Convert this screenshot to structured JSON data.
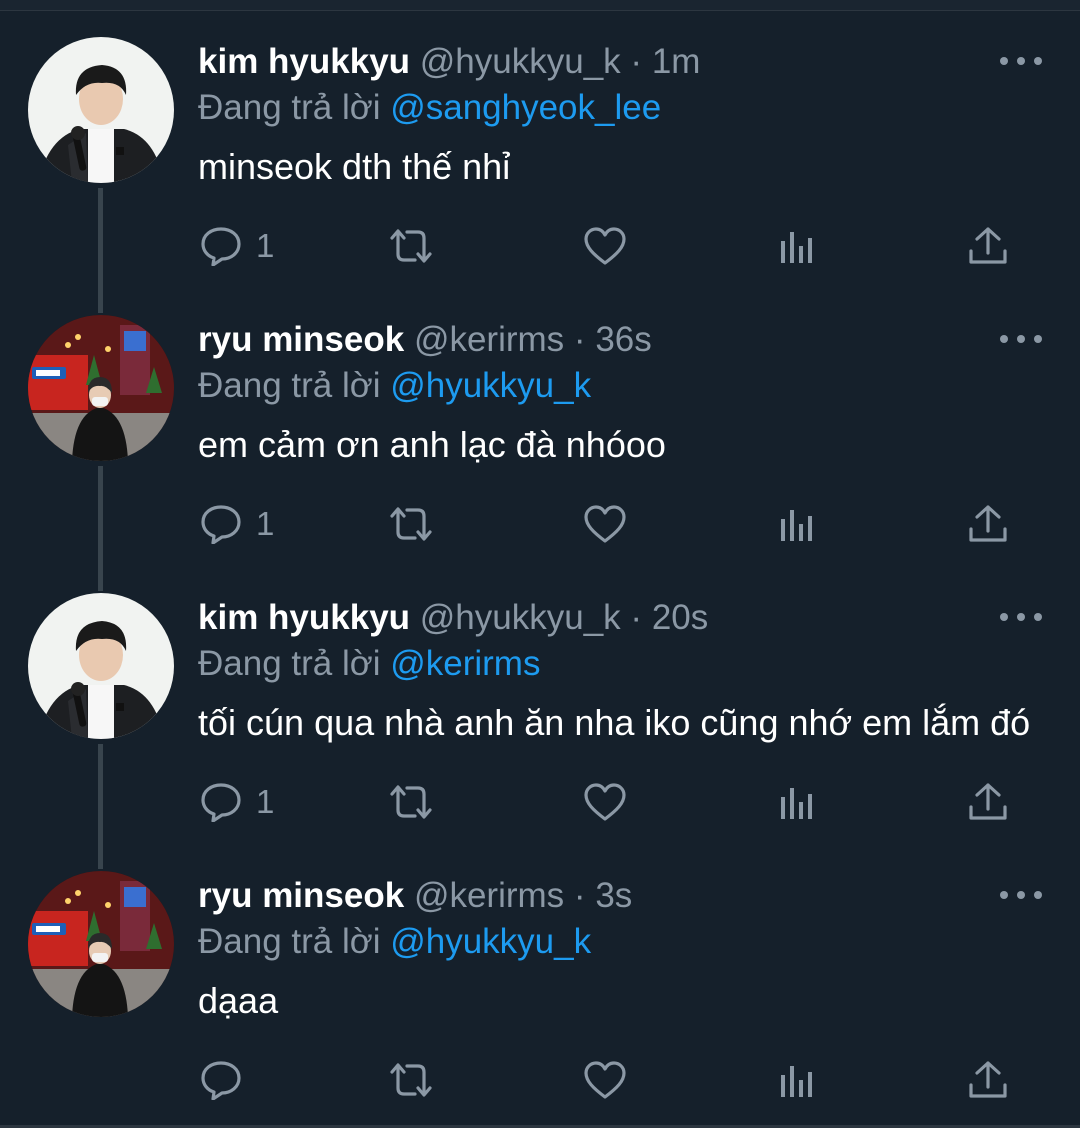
{
  "reply_prefix": "Đang trả lời",
  "colors": {
    "background": "#15202b",
    "text": "#ffffff",
    "muted": "#8b98a5",
    "link": "#1d9bf0",
    "thread_line": "#38444d"
  },
  "icons": {
    "reply": "reply-icon",
    "retweet": "retweet-icon",
    "like": "heart-icon",
    "analytics": "analytics-icon",
    "share": "share-icon",
    "more": "more-options-icon"
  },
  "tweets": [
    {
      "display_name": "kim hyukkyu",
      "handle": "@hyukkyu_k",
      "separator": "·",
      "time": "1m",
      "reply_to": "@sanghyeok_lee",
      "text": "minseok dth thế nhỉ",
      "reply_count": "1",
      "avatar": "kim-hyukkyu-avatar"
    },
    {
      "display_name": "ryu minseok",
      "handle": "@kerirms",
      "separator": "·",
      "time": "36s",
      "reply_to": "@hyukkyu_k",
      "text": "em cảm ơn anh lạc đà nhóoo",
      "reply_count": "1",
      "avatar": "ryu-minseok-avatar"
    },
    {
      "display_name": "kim hyukkyu",
      "handle": "@hyukkyu_k",
      "separator": "·",
      "time": "20s",
      "reply_to": "@kerirms",
      "text": "tối cún qua nhà anh ăn nha iko cũng nhớ em lắm đó",
      "reply_count": "1",
      "avatar": "kim-hyukkyu-avatar"
    },
    {
      "display_name": "ryu minseok",
      "handle": "@kerirms",
      "separator": "·",
      "time": "3s",
      "reply_to": "@hyukkyu_k",
      "text": "dạaa",
      "reply_count": "",
      "avatar": "ryu-minseok-avatar"
    }
  ]
}
